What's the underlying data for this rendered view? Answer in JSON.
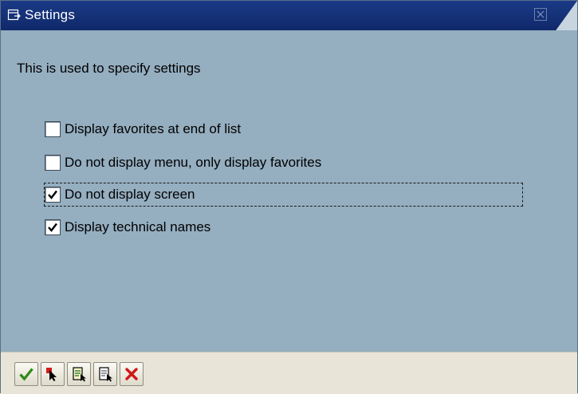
{
  "window": {
    "title": "Settings",
    "colors": {
      "titlebar": "#143075",
      "body": "#95aec0",
      "toolbar": "#e8e5d8"
    }
  },
  "content": {
    "description": "This is used to specify settings",
    "options": [
      {
        "label": "Display favorites at end of list",
        "checked": false,
        "focused": false
      },
      {
        "label": "Do not display menu, only display favorites",
        "checked": false,
        "focused": false
      },
      {
        "label": "Do not display screen",
        "checked": true,
        "focused": true
      },
      {
        "label": "Display technical names",
        "checked": true,
        "focused": false
      }
    ]
  },
  "toolbar": {
    "buttons": [
      {
        "icon": "checkmark-icon"
      },
      {
        "icon": "select-cursor-icon"
      },
      {
        "icon": "document-list-icon"
      },
      {
        "icon": "document-edit-icon"
      },
      {
        "icon": "cancel-x-icon"
      }
    ]
  }
}
